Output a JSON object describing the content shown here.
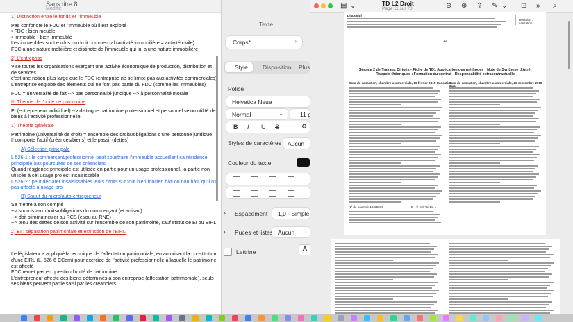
{
  "left_doc": {
    "title": "Sans titre 8",
    "subtitle": "Modifié",
    "lines": [
      {
        "t": "1) Distinction entre le fonds et l'immeuble",
        "c": "red",
        "u": true
      },
      {
        "t": ""
      },
      {
        "t": "Pas confondre le FDC et l'immeuble où il est exploité"
      },
      {
        "t": "• FDC : bien meuble"
      },
      {
        "t": "• Immeuble : bien immeuble"
      },
      {
        "t": "Les immeubles sont exclus du droit commercial (activité immobilière = activité civile)"
      },
      {
        "t": "FDC a une nature mobilière et distincte de l'immeuble qui lui a une nature immobilière"
      },
      {
        "t": ""
      },
      {
        "t": "2) L'entreprise",
        "c": "red",
        "u": true
      },
      {
        "t": ""
      },
      {
        "t": "Vise toutes les organisations exerçant une activité économique de production, distribution et de services"
      },
      {
        "t": "c'est une notion plus large que le FDC (entreprise ne se limite pas aux activités commerciales)"
      },
      {
        "t": "L'entreprise englobe des éléments qui ne font pas partie du FDC (comme les immeubles)"
      },
      {
        "t": ""
      },
      {
        "t": "FDC = universalité de fait --> pas personnalité juridique --> à personnalité morale"
      },
      {
        "t": ""
      },
      {
        "t": "II- Théorie de l'unité de patrimoine",
        "c": "red",
        "u": true
      },
      {
        "t": ""
      },
      {
        "t": "EI (entrepreneur individuel) --> distingue patrimoine professionnel et personnel selon utilité des biens à l'activité professionnelle"
      },
      {
        "t": ""
      },
      {
        "t": "1) Théorie générale",
        "c": "red",
        "u": true
      },
      {
        "t": ""
      },
      {
        "t": "Patrimoine (universalité de droit) = ensemble des droits/obligations d'une personne juridique"
      },
      {
        "t": "Il comporte l'actif (créances/biens) et le passif (dettes)"
      },
      {
        "t": ""
      },
      {
        "t": "A) Sélection principale",
        "c": "blue",
        "u": true,
        "i": true
      },
      {
        "t": ""
      },
      {
        "t": "L 526-1 : le commerçant/professionnel peut soustraire l'immeuble accueillant sa résidence principale aux poursuites de ses créanciers",
        "c": "blue"
      },
      {
        "t": "Quand résidence principale est utilisée en partie pour un usage professionnel, la partie non utilisée à cet usage pro est insaisissable"
      },
      {
        "t": "L 526-2 : peut déclarer insaisissables leurs droits sur tout bien foncier, bâti ou non bâti, qu'il n'a pas affecté à usage pro",
        "c": "blue"
      },
      {
        "t": ""
      },
      {
        "t": "B) Statut du micro/auto-entrepreneur",
        "c": "blue",
        "u": true,
        "i": true
      },
      {
        "t": ""
      },
      {
        "t": "Se mettre à son compté"
      },
      {
        "t": "--> sourcis aux droits/obligations du commerçant (et artisan)"
      },
      {
        "t": "--> doit s'immatriculer au RCS (et/ou au RNE)"
      },
      {
        "t": "--> tenu des dettes de son activité sur l'ensemble de son patrimoine, sauf statut de EI ou EIRL"
      },
      {
        "t": ""
      },
      {
        "t": "2) EI : séparation patrimoniale et extinction de l'EIRL",
        "c": "red",
        "u": true
      },
      {
        "t": ""
      },
      {
        "t": ""
      },
      {
        "t": ""
      },
      {
        "t": ""
      },
      {
        "t": ""
      },
      {
        "t": ""
      },
      {
        "t": "Le législateur a appliqué la technique de l'affectation patrimoniale, en autorisant la constitution d'une EIRL (L. 526-6 CCom) pour exercice de l'activité professionnelle à laquelle le patrimoine est affecté"
      },
      {
        "t": "FDC remet pas en question l'unité de patrimoine"
      },
      {
        "t": "L'entrepreneur affecte des biens déterminés à son entreprise (affectation patrimoniale), seuls ses biens peuvent partie saisi par les créanciers"
      }
    ]
  },
  "sidebar": {
    "title": "Texte",
    "style_value": "Corps*",
    "tabs": [
      "Style",
      "Disposition",
      "Plus"
    ],
    "police_label": "Police",
    "font_value": "Helvetica Neue",
    "weight_value": "Normal",
    "size_value": "11 pt",
    "styles_label": "Styles de caractères",
    "styles_value": "Aucun",
    "color_label": "Couleur du texte",
    "spacing_label": "Espacement",
    "spacing_value": "1,0 - Simple",
    "bullets_label": "Puces et listes",
    "bullets_value": "Aucun",
    "lettrine_label": "Lettrine",
    "bold": "B",
    "italic": "I",
    "underline": "U",
    "strike": "S",
    "text_color": "#111111"
  },
  "pdf": {
    "title": "TD L2 Droit",
    "subtitle": "Page 11 sur 70",
    "page_number": "10",
    "header_left": "Dispositif",
    "header_right": "Décision : cassation",
    "sheet_title": "Séance 2 de Travaux Dirigés - Fiche de TD1 Application des méthodes : Note de Synthèse d'Arrêt",
    "sheet_subtitle": "Rappels théoriques : Formation du contrat - Responsabilité extracontractuelle",
    "case_left": "Cour de cassation, chambre commerciale, 10 février 2015     Cassation",
    "case_right": "Cour de cassation, chambre commerciale, 26 septembre 2018     Rejet.",
    "footer_left": "N° de pourvoi: 13-25066",
    "footer_right": "B · © Sel Tol Bu L"
  },
  "colors": {
    "red": "#cc2b22",
    "blue": "#2b6fd6"
  }
}
